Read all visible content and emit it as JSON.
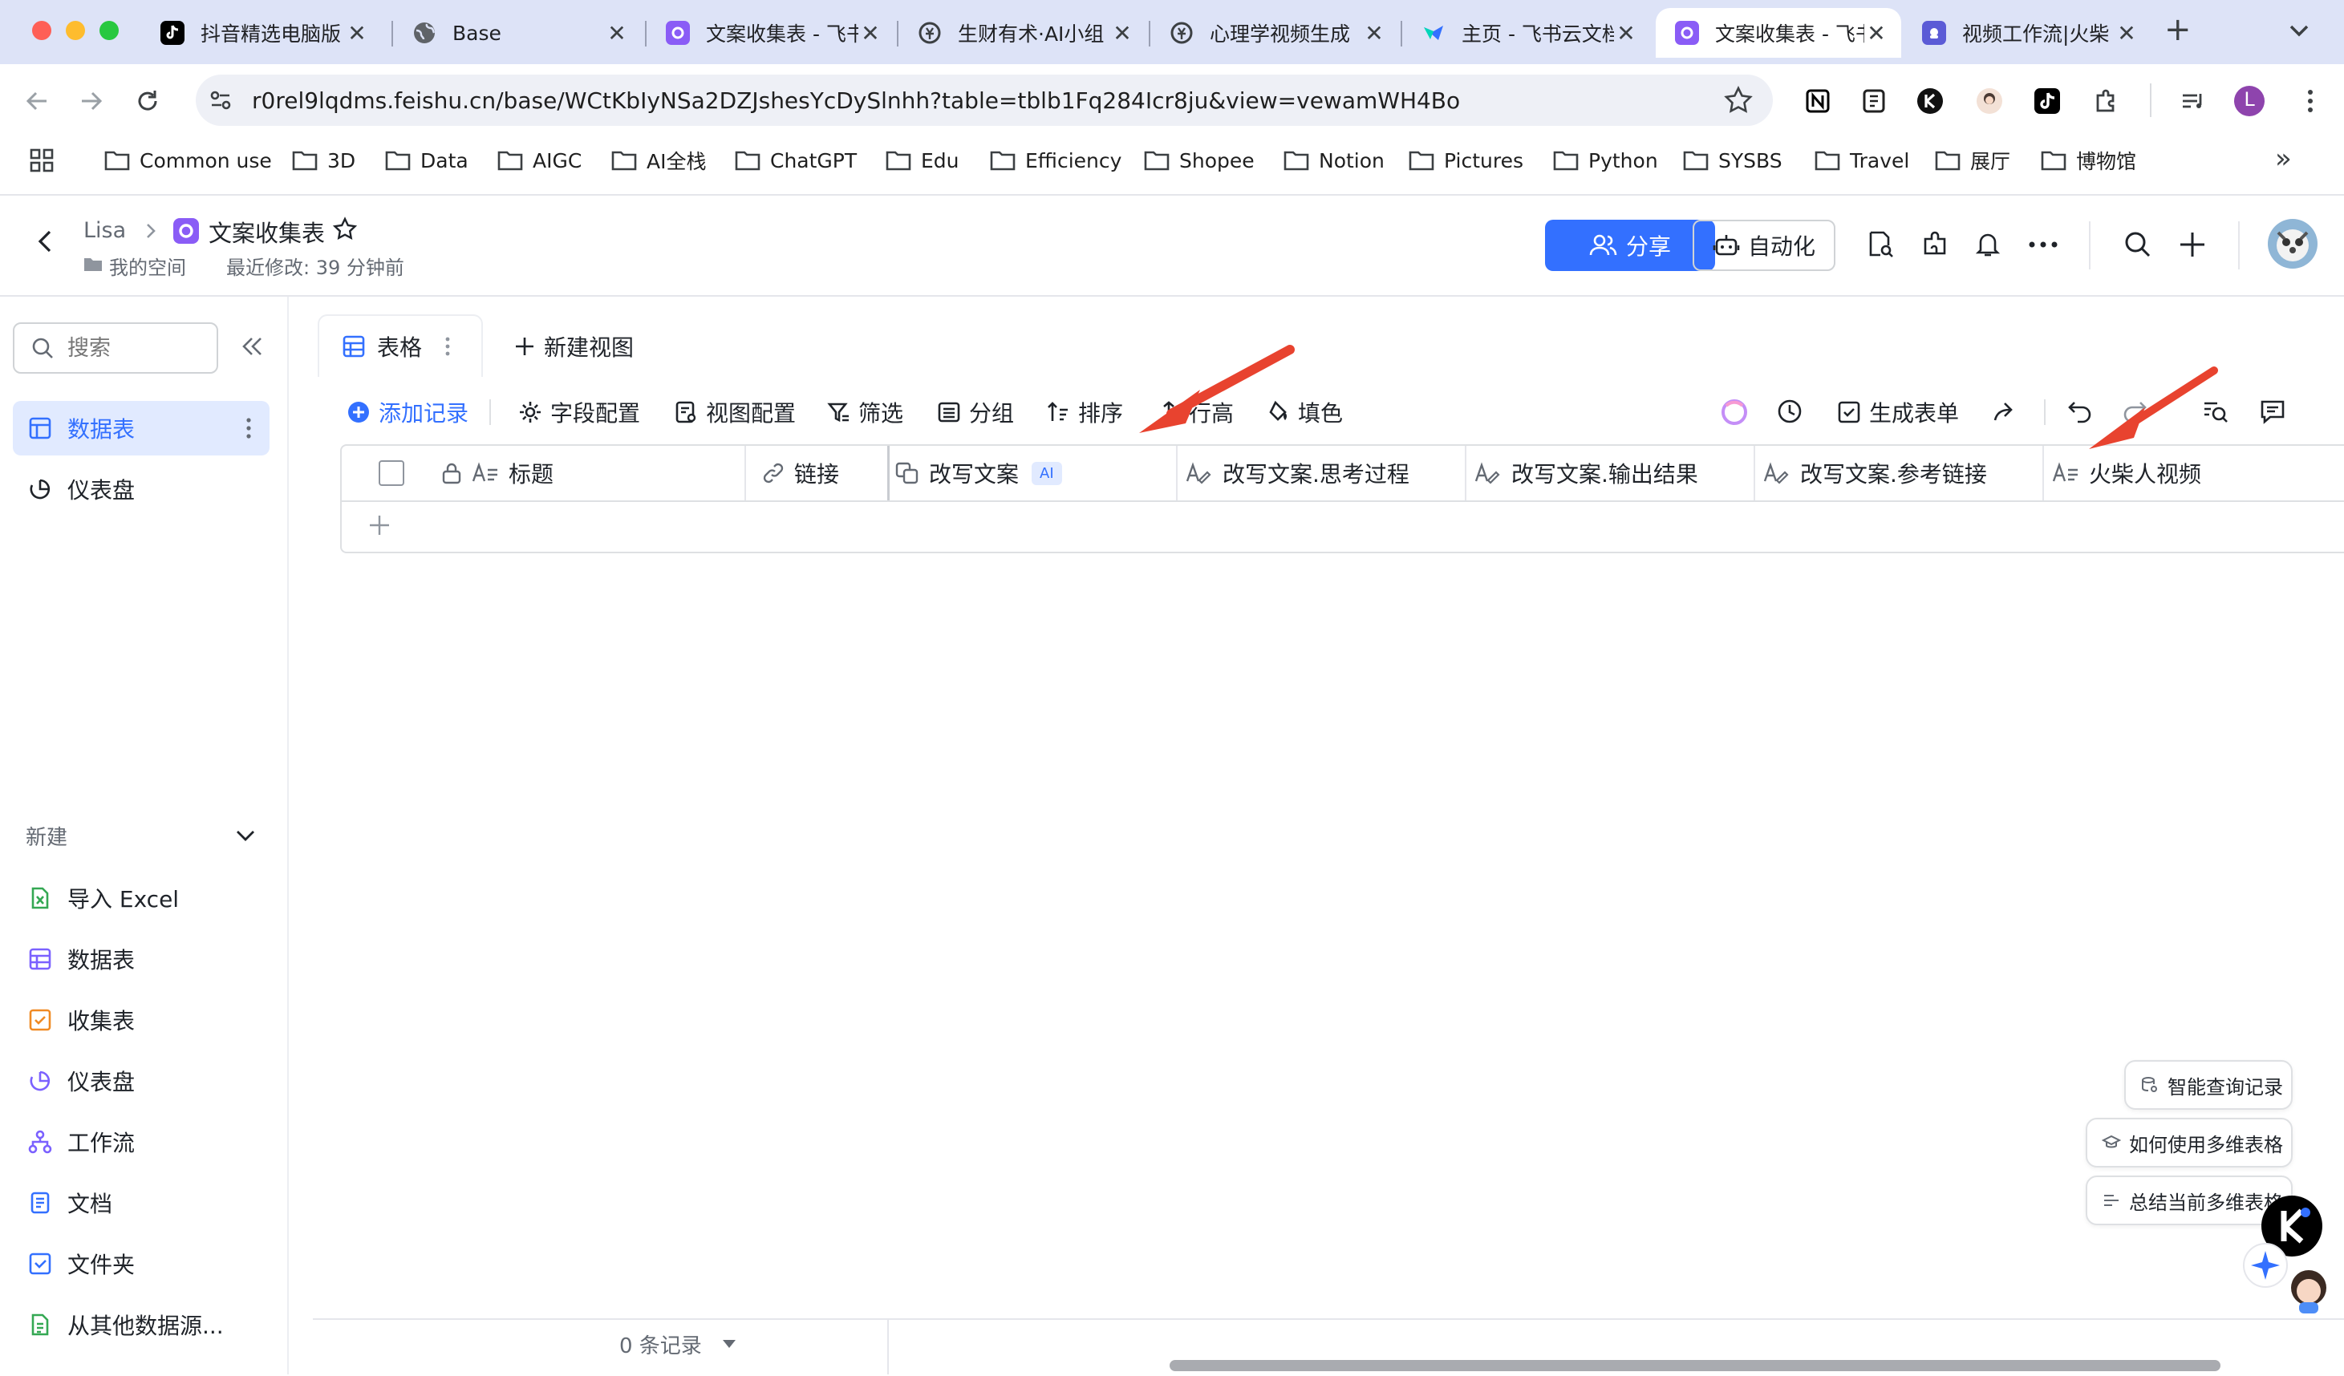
{
  "browser": {
    "tabs": [
      {
        "title": "抖音精选电脑版",
        "close": "✕"
      },
      {
        "title": "Base",
        "close": "✕"
      },
      {
        "title": "文案收集表 - 飞书",
        "close": "✕"
      },
      {
        "title": "生财有术·AI小组",
        "close": "✕"
      },
      {
        "title": "心理学视频生成",
        "close": "✕"
      },
      {
        "title": "主页 - 飞书云文档",
        "close": "✕"
      },
      {
        "title": "文案收集表 - 飞书",
        "close": "✕"
      },
      {
        "title": "视频工作流|火柴",
        "close": "✕"
      }
    ],
    "new_tab": "+",
    "url": "r0rel9lqdms.feishu.cn/base/WCtKbIyNSa2DZJshesYcDySlnhh?table=tblb1Fq284Icr8ju&view=vewamWH4Bo",
    "profile_initial": "L",
    "bookmarks": [
      "Common use",
      "3D",
      "Data",
      "AIGC",
      "AI全栈",
      "ChatGPT",
      "Edu",
      "Efficiency",
      "Shopee",
      "Notion",
      "Pictures",
      "Python",
      "SYSBS",
      "Travel",
      "展厅",
      "博物馆"
    ],
    "bookmarks_more": "»"
  },
  "header": {
    "breadcrumb_owner": "Lisa",
    "doc_title": "文案收集表",
    "location": "我的空间",
    "last_modified": "最近修改: 39 分钟前",
    "share_label": "分享",
    "automation_label": "自动化"
  },
  "sidebar": {
    "search_placeholder": "搜索",
    "items": [
      {
        "label": "数据表"
      },
      {
        "label": "仪表盘"
      }
    ],
    "new_section_label": "新建",
    "new_items": [
      {
        "label": "导入 Excel"
      },
      {
        "label": "数据表"
      },
      {
        "label": "收集表"
      },
      {
        "label": "仪表盘"
      },
      {
        "label": "工作流"
      },
      {
        "label": "文档"
      },
      {
        "label": "文件夹"
      },
      {
        "label": "从其他数据源..."
      }
    ]
  },
  "views": {
    "active_view": "表格",
    "new_view": "新建视图"
  },
  "toolbar": {
    "add_record": "添加记录",
    "field_config": "字段配置",
    "view_config": "视图配置",
    "filter": "筛选",
    "group": "分组",
    "sort": "排序",
    "row_height": "行高",
    "fill_color": "填色",
    "generate_form": "生成表单"
  },
  "table": {
    "columns": [
      {
        "label": "标题"
      },
      {
        "label": "链接"
      },
      {
        "label": "改写文案",
        "badge": "AI"
      },
      {
        "label": "改写文案.思考过程"
      },
      {
        "label": "改写文案.输出结果"
      },
      {
        "label": "改写文案.参考链接"
      },
      {
        "label": "火柴人视频"
      }
    ],
    "record_count": "0 条记录"
  },
  "floating": {
    "smart_query": "智能查询记录",
    "how_to_use": "如何使用多维表格",
    "summarize": "总结当前多维表格"
  },
  "colors": {
    "accent": "#3370ff",
    "tabstrip": "#dde3f7",
    "arrow": "#e8432f"
  }
}
